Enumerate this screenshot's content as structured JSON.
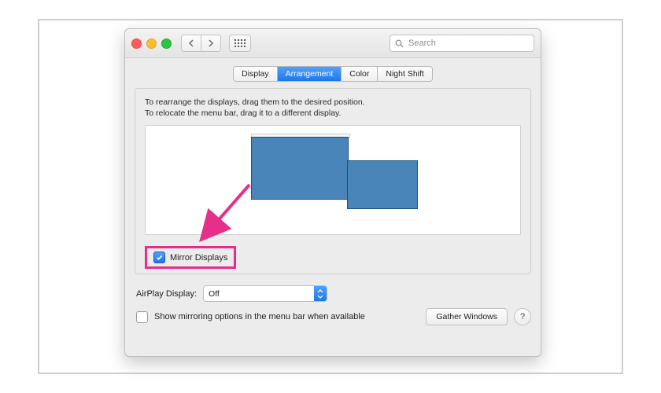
{
  "search": {
    "placeholder": "Search"
  },
  "tabs": {
    "t0": "Display",
    "t1": "Arrangement",
    "t2": "Color",
    "t3": "Night Shift"
  },
  "hint": {
    "l1": "To rearrange the displays, drag them to the desired position.",
    "l2": "To relocate the menu bar, drag it to a different display."
  },
  "mirror": {
    "label": "Mirror Displays"
  },
  "airplay": {
    "label": "AirPlay Display:",
    "value": "Off"
  },
  "showMirroring": {
    "label": "Show mirroring options in the menu bar when available"
  },
  "buttons": {
    "gather": "Gather Windows",
    "help": "?"
  },
  "annotation": {
    "color": "#e52f8a"
  }
}
